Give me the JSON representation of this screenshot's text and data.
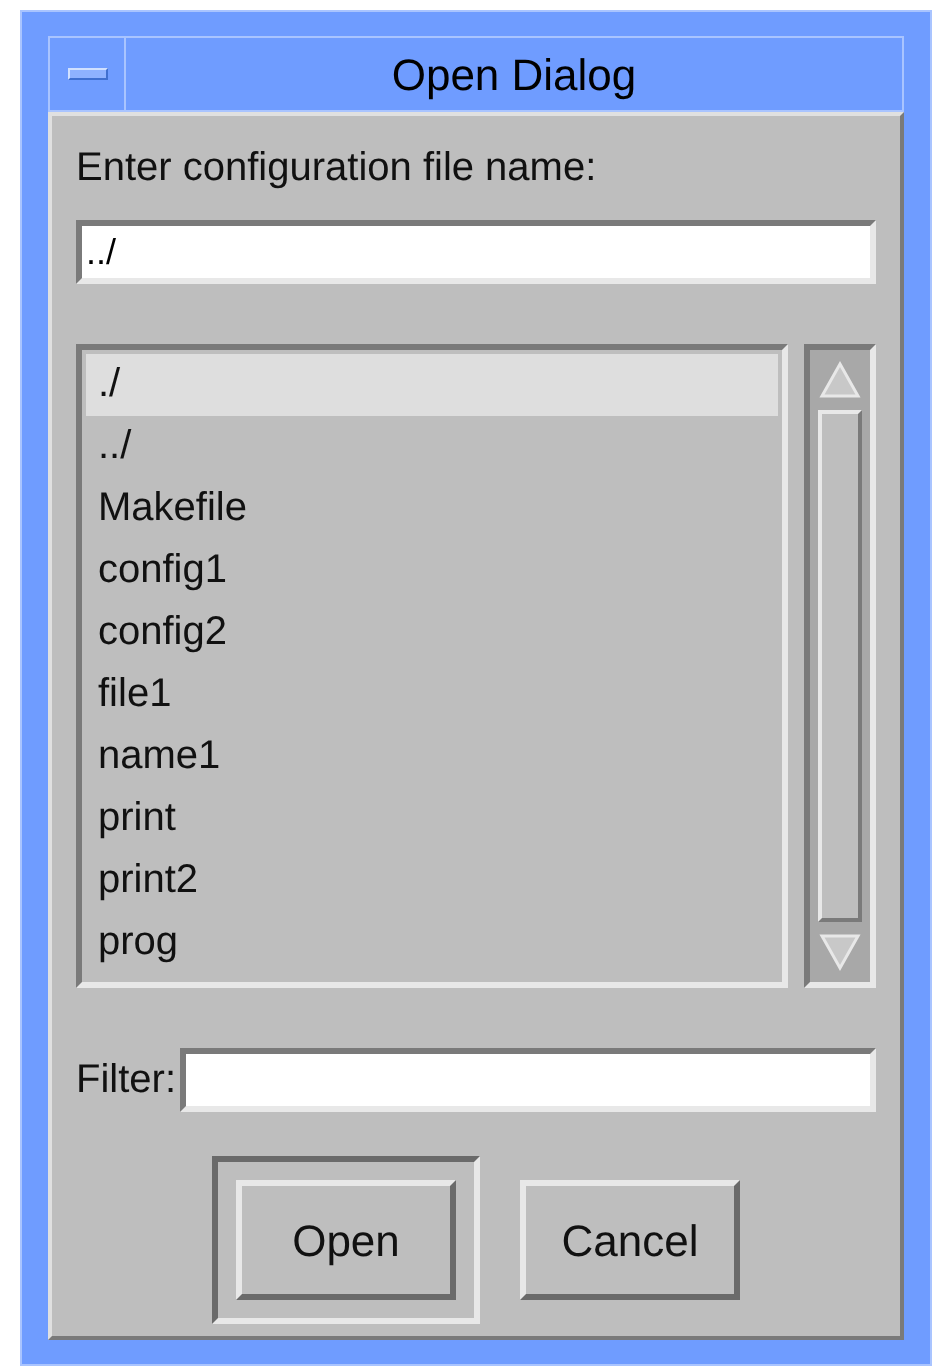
{
  "window": {
    "title": "Open Dialog"
  },
  "prompt": "Enter configuration file name:",
  "file_name": {
    "value": "../"
  },
  "files": [
    {
      "name": "./",
      "selected": true
    },
    {
      "name": "../",
      "selected": false
    },
    {
      "name": "Makefile",
      "selected": false
    },
    {
      "name": "config1",
      "selected": false
    },
    {
      "name": "config2",
      "selected": false
    },
    {
      "name": "file1",
      "selected": false
    },
    {
      "name": "name1",
      "selected": false
    },
    {
      "name": "print",
      "selected": false
    },
    {
      "name": "print2",
      "selected": false
    },
    {
      "name": "prog",
      "selected": false
    }
  ],
  "filter": {
    "label": "Filter:"
  },
  "buttons": [
    {
      "label": "Open",
      "default": true
    },
    {
      "label": "Cancel",
      "default": false
    }
  ]
}
